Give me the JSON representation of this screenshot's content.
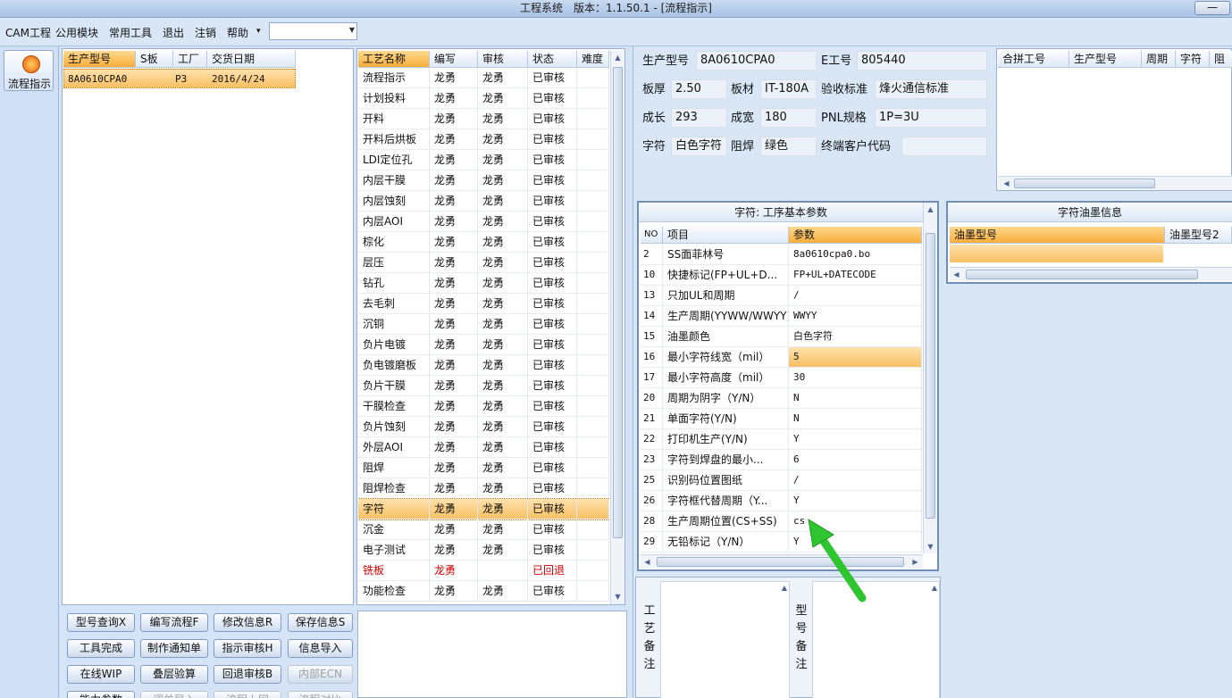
{
  "window": {
    "title": "工程系统　版本：1.1.50.1 - [流程指示]",
    "min_label": "—"
  },
  "menu": {
    "items": [
      "CAM工程",
      "公用模块",
      "常用工具",
      "退出",
      "注销",
      "帮助"
    ],
    "help_arrow": "▾",
    "combo_value": ""
  },
  "nav": {
    "flow_label": "流程指示"
  },
  "orders": {
    "columns": [
      "生产型号",
      "S板",
      "工厂",
      "交货日期"
    ],
    "rows": [
      {
        "model": "8A0610CPA0",
        "s": "",
        "factory": "P3",
        "date": "2016/4/24"
      }
    ]
  },
  "process": {
    "columns": [
      "工艺名称",
      "编写",
      "审核",
      "状态",
      "难度"
    ],
    "rows": [
      {
        "name": "流程指示",
        "author": "龙勇",
        "reviewer": "龙勇",
        "status": "已审核"
      },
      {
        "name": "计划投料",
        "author": "龙勇",
        "reviewer": "龙勇",
        "status": "已审核"
      },
      {
        "name": "开料",
        "author": "龙勇",
        "reviewer": "龙勇",
        "status": "已审核"
      },
      {
        "name": "开料后烘板",
        "author": "龙勇",
        "reviewer": "龙勇",
        "status": "已审核"
      },
      {
        "name": "LDI定位孔",
        "author": "龙勇",
        "reviewer": "龙勇",
        "status": "已审核"
      },
      {
        "name": "内层干膜",
        "author": "龙勇",
        "reviewer": "龙勇",
        "status": "已审核"
      },
      {
        "name": "内层蚀刻",
        "author": "龙勇",
        "reviewer": "龙勇",
        "status": "已审核"
      },
      {
        "name": "内层AOI",
        "author": "龙勇",
        "reviewer": "龙勇",
        "status": "已审核"
      },
      {
        "name": "棕化",
        "author": "龙勇",
        "reviewer": "龙勇",
        "status": "已审核"
      },
      {
        "name": "层压",
        "author": "龙勇",
        "reviewer": "龙勇",
        "status": "已审核"
      },
      {
        "name": "钻孔",
        "author": "龙勇",
        "reviewer": "龙勇",
        "status": "已审核"
      },
      {
        "name": "去毛刺",
        "author": "龙勇",
        "reviewer": "龙勇",
        "status": "已审核"
      },
      {
        "name": "沉铜",
        "author": "龙勇",
        "reviewer": "龙勇",
        "status": "已审核"
      },
      {
        "name": "负片电镀",
        "author": "龙勇",
        "reviewer": "龙勇",
        "status": "已审核"
      },
      {
        "name": "负电镀磨板",
        "author": "龙勇",
        "reviewer": "龙勇",
        "status": "已审核"
      },
      {
        "name": "负片干膜",
        "author": "龙勇",
        "reviewer": "龙勇",
        "status": "已审核"
      },
      {
        "name": "干膜检查",
        "author": "龙勇",
        "reviewer": "龙勇",
        "status": "已审核"
      },
      {
        "name": "负片蚀刻",
        "author": "龙勇",
        "reviewer": "龙勇",
        "status": "已审核"
      },
      {
        "name": "外层AOI",
        "author": "龙勇",
        "reviewer": "龙勇",
        "status": "已审核"
      },
      {
        "name": "阻焊",
        "author": "龙勇",
        "reviewer": "龙勇",
        "status": "已审核"
      },
      {
        "name": "阻焊检查",
        "author": "龙勇",
        "reviewer": "龙勇",
        "status": "已审核"
      },
      {
        "name": "字符",
        "author": "龙勇",
        "reviewer": "龙勇",
        "status": "已审核"
      },
      {
        "name": "沉金",
        "author": "龙勇",
        "reviewer": "龙勇",
        "status": "已审核"
      },
      {
        "name": "电子测试",
        "author": "龙勇",
        "reviewer": "龙勇",
        "status": "已审核"
      },
      {
        "name": "铣板",
        "author": "龙勇",
        "reviewer": "",
        "status": "已回退"
      },
      {
        "name": "功能检查",
        "author": "龙勇",
        "reviewer": "龙勇",
        "status": "已审核"
      }
    ]
  },
  "buttons": [
    [
      "型号查询X",
      "编写流程F",
      "修改信息R",
      "保存信息S"
    ],
    [
      "工具完成",
      "制作通知单",
      "指示审核H",
      "信息导入"
    ],
    [
      "在线WIP",
      "叠层验算",
      "回退审核B",
      "内部ECN"
    ],
    [
      "能力参数",
      "调单导入",
      "流程上网",
      "流程对比"
    ]
  ],
  "info": {
    "model_label": "生产型号",
    "model_value": "8A0610CPA0",
    "e_label": "E工号",
    "e_value": "805440",
    "thickness_label": "板厚",
    "thickness_value": "2.50",
    "material_label": "板材",
    "material_value": "IT-180A",
    "standard_label": "验收标准",
    "standard_value": "烽火通信标准",
    "length_label": "成长",
    "length_value": "293",
    "width_label": "成宽",
    "width_value": "180",
    "pnl_label": "PNL规格",
    "pnl_value": "1P=3U",
    "char_label": "字符",
    "char_value": "白色字符",
    "mask_label": "阻焊",
    "mask_value": "绿色",
    "customer_label": "终端客户代码",
    "customer_value": ""
  },
  "merge": {
    "columns": [
      "合拼工号",
      "生产型号",
      "周期",
      "字符",
      "阻焊"
    ]
  },
  "params": {
    "title": "字符: 工序基本参数",
    "columns": [
      "NO",
      "项目",
      "参数"
    ],
    "rows": [
      {
        "no": "2",
        "item": "SS面菲林号",
        "value": "8a0610cpa0.bo"
      },
      {
        "no": "10",
        "item": "快捷标记(FP+UL+D...",
        "value": "FP+UL+DATECODE"
      },
      {
        "no": "13",
        "item": "只加UL和周期",
        "value": "/"
      },
      {
        "no": "14",
        "item": "生产周期(YYWW/WWYY)",
        "value": "WWYY"
      },
      {
        "no": "15",
        "item": "油墨颜色",
        "value": "白色字符"
      },
      {
        "no": "16",
        "item": "最小字符线宽（mil）",
        "value": "5"
      },
      {
        "no": "17",
        "item": "最小字符高度（mil）",
        "value": "30"
      },
      {
        "no": "20",
        "item": "周期为阴字（Y/N）",
        "value": "N"
      },
      {
        "no": "21",
        "item": "单面字符(Y/N)",
        "value": "N"
      },
      {
        "no": "22",
        "item": "打印机生产(Y/N)",
        "value": "Y"
      },
      {
        "no": "23",
        "item": "字符到焊盘的最小...",
        "value": "6"
      },
      {
        "no": "25",
        "item": "识别码位置图纸",
        "value": "/"
      },
      {
        "no": "26",
        "item": "字符框代替周期（Y...",
        "value": "Y"
      },
      {
        "no": "28",
        "item": "生产周期位置(CS+SS)",
        "value": "cs"
      },
      {
        "no": "29",
        "item": "无铅标记（Y/N）",
        "value": "Y"
      }
    ]
  },
  "ink": {
    "title": "字符油墨信息",
    "columns": [
      "油墨型号",
      "油墨型号2"
    ]
  },
  "notes": {
    "process_label": "工艺备注",
    "model_label": "型号备注"
  },
  "colors": {
    "selection": "#f7bf62",
    "arrow": "#2fc531",
    "header": "#dfe9f6",
    "returned": "#d40000"
  }
}
